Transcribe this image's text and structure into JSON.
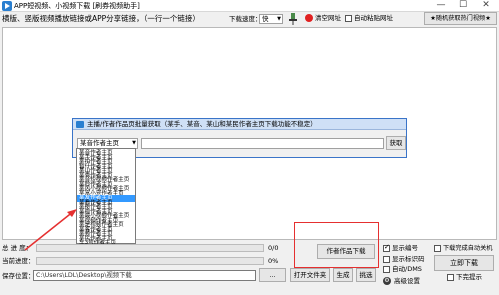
{
  "window": {
    "title": "APP短视频、小视频下载 [刷券视频助手]",
    "minimize": "—",
    "maximize": "☐",
    "close": "✕"
  },
  "toolbar": {
    "hint": "横版、竖版视频播放链接或APP分享链接，（一行一个链接）",
    "speed_label": "下载速度：",
    "speed_value": "快",
    "clear_label": "清空网址",
    "auto_paste_label": "自动粘贴网址",
    "random_btn": "★随机获取热门视频★"
  },
  "dialog": {
    "title": "主播/作者作品页批量获取（某手、某音、某山和某民作者主页下载功能不稳定）",
    "select_value": "某音作者主页",
    "fetch_btn": "获取",
    "options": [
      "某音作者主页",
      "某手作者主页",
      "某拍作者主页",
      "暂什作者主页",
      "某山作者主页",
      "某秀作者主页",
      "某音短视频作者主页",
      "某秒作者主页",
      "某风小视频作者主页",
      "某富小宠作者主页",
      "某友作者主页",
      "某看作者主页",
      "某秘作者主页",
      "某啦作者主页",
      "某最小视频作者主页",
      "某视频作者主页",
      "某是视频作者主页",
      "某客作者主页",
      "某频作者主页",
      "某民作者主页",
      "车3号作者主页"
    ],
    "selected_index": 10
  },
  "progress": {
    "total_label": "总 进 度：",
    "total_value": "0/0",
    "current_label": "当前进度：",
    "current_value": "0%"
  },
  "save": {
    "label": "保存位置：",
    "path": "C:\\Users\\LDL\\Desktop\\视频下载"
  },
  "buttons": {
    "open_folder": "打开文件夹",
    "generate": "生成",
    "pick": "挑选",
    "works_download": "作者作品下载",
    "download_now": "立即下载"
  },
  "options": {
    "show_number": "显示编号",
    "show_number_checked": true,
    "show_watermark": "显示标识码",
    "show_watermark_checked": false,
    "auto_mp4": "自动/DMS",
    "auto_mp4_checked": false,
    "advanced": "高级设置",
    "auto_close": "下载完成自动关机",
    "auto_close_checked": false,
    "finish_hint": "下完提示",
    "finish_hint_checked": false
  }
}
